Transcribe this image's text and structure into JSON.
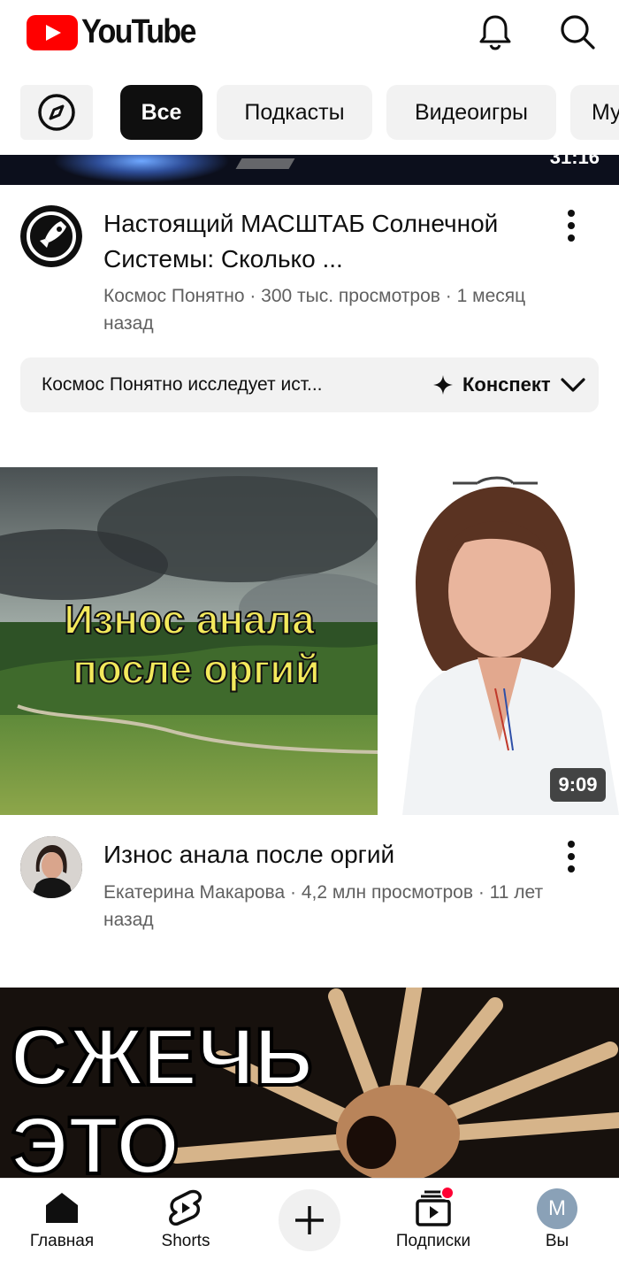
{
  "header": {
    "logo_text": "YouTube",
    "icons": [
      "notifications-icon",
      "search-icon"
    ]
  },
  "chips": {
    "explore_icon": "compass-icon",
    "items": [
      "Все",
      "Подкасты",
      "Видеоигры",
      "Му"
    ]
  },
  "videos": [
    {
      "duration": "31:16",
      "title": "Настоящий МАСШТАБ Солнечной Системы: Сколько ...",
      "channel": "Космос Понятно",
      "views": "300 тыс. просмотров",
      "age": "1 месяц назад",
      "summary_text": "Космос Понятно исследует ист...",
      "summary_button": "Конспект"
    },
    {
      "thumbnail_text_line1": "Износ анала",
      "thumbnail_text_line2": "после оргий",
      "duration": "9:09",
      "title": "Износ анала после оргий",
      "channel": "Екатерина Макарова",
      "views": "4,2 млн просмотров",
      "age": "11 лет назад"
    },
    {
      "thumbnail_text_line1": "СЖЕЧЬ",
      "thumbnail_text_line2": "ЭТО"
    }
  ],
  "nav": {
    "home": "Главная",
    "shorts": "Shorts",
    "subscriptions": "Подписки",
    "you": "Вы",
    "you_avatar_letter": "M"
  },
  "colors": {
    "brand_red": "#ff0000",
    "chip_bg": "#f2f2f2",
    "active_chip": "#0f0f0f",
    "secondary_text": "#606060"
  }
}
